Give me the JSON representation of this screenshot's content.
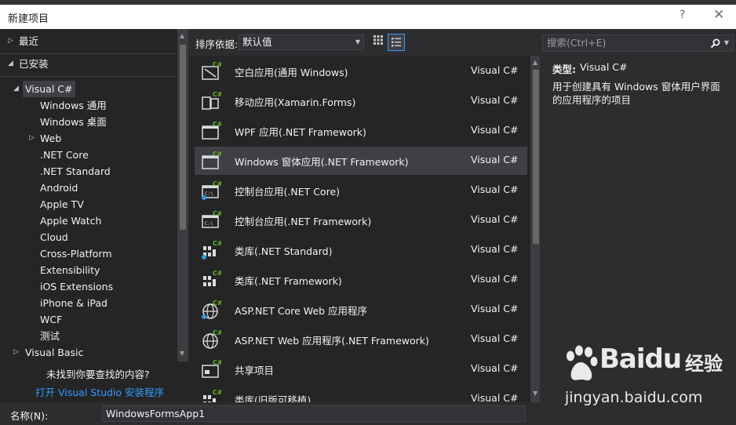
{
  "window": {
    "title": "新建项目",
    "help_glyph": "?",
    "close_glyph": "✕"
  },
  "tree": {
    "recent": "最近",
    "installed": "已安装",
    "visual_csharp": "Visual C#",
    "children": [
      "Windows 通用",
      "Windows 桌面",
      "Web",
      ".NET Core",
      ".NET Standard",
      "Android",
      "Apple TV",
      "Apple Watch",
      "Cloud",
      "Cross-Platform",
      "Extensibility",
      "iOS Extensions",
      "iPhone & iPad",
      "WCF",
      "测试"
    ],
    "visual_basic": "Visual Basic",
    "not_found": "未找到你要查找的内容?",
    "installer_link": "打开 Visual Studio 安装程序"
  },
  "toolbar": {
    "sort_label": "排序依据:",
    "sort_value": "默认值"
  },
  "templates": [
    {
      "name": "空白应用(通用 Windows)",
      "lang": "Visual C#",
      "icon": "blank-uwp-icon"
    },
    {
      "name": "移动应用(Xamarin.Forms)",
      "lang": "Visual C#",
      "icon": "mobile-app-icon"
    },
    {
      "name": "WPF 应用(.NET Framework)",
      "lang": "Visual C#",
      "icon": "wpf-app-icon"
    },
    {
      "name": "Windows 窗体应用(.NET Framework)",
      "lang": "Visual C#",
      "icon": "winforms-app-icon"
    },
    {
      "name": "控制台应用(.NET Core)",
      "lang": "Visual C#",
      "icon": "console-core-icon"
    },
    {
      "name": "控制台应用(.NET Framework)",
      "lang": "Visual C#",
      "icon": "console-framework-icon"
    },
    {
      "name": "类库(.NET Standard)",
      "lang": "Visual C#",
      "icon": "class-library-standard-icon"
    },
    {
      "name": "类库(.NET Framework)",
      "lang": "Visual C#",
      "icon": "class-library-framework-icon"
    },
    {
      "name": "ASP.NET Core Web 应用程序",
      "lang": "Visual C#",
      "icon": "aspnet-core-icon"
    },
    {
      "name": "ASP.NET Web 应用程序(.NET Framework)",
      "lang": "Visual C#",
      "icon": "aspnet-web-icon"
    },
    {
      "name": "共享项目",
      "lang": "Visual C#",
      "icon": "shared-project-icon"
    },
    {
      "name": "类库(旧版可移植)",
      "lang": "Visual C#",
      "icon": "portable-library-icon"
    }
  ],
  "selected_template_index": 3,
  "search": {
    "placeholder": "搜索(Ctrl+E)"
  },
  "details": {
    "type_label": "类型:",
    "type_value": "Visual C#",
    "description": "用于创建具有 Windows 窗体用户界面的应用程序的项目"
  },
  "bottom": {
    "name_label": "名称(N):",
    "name_value": "WindowsFormsApp1"
  },
  "watermark": {
    "brand": "Baidu",
    "brand_cn": "经验",
    "url": "jingyan.baidu.com"
  },
  "colors": {
    "accent": "#3399ff",
    "csharp_badge": "#68b723",
    "selected_row": "#3f3f46"
  }
}
